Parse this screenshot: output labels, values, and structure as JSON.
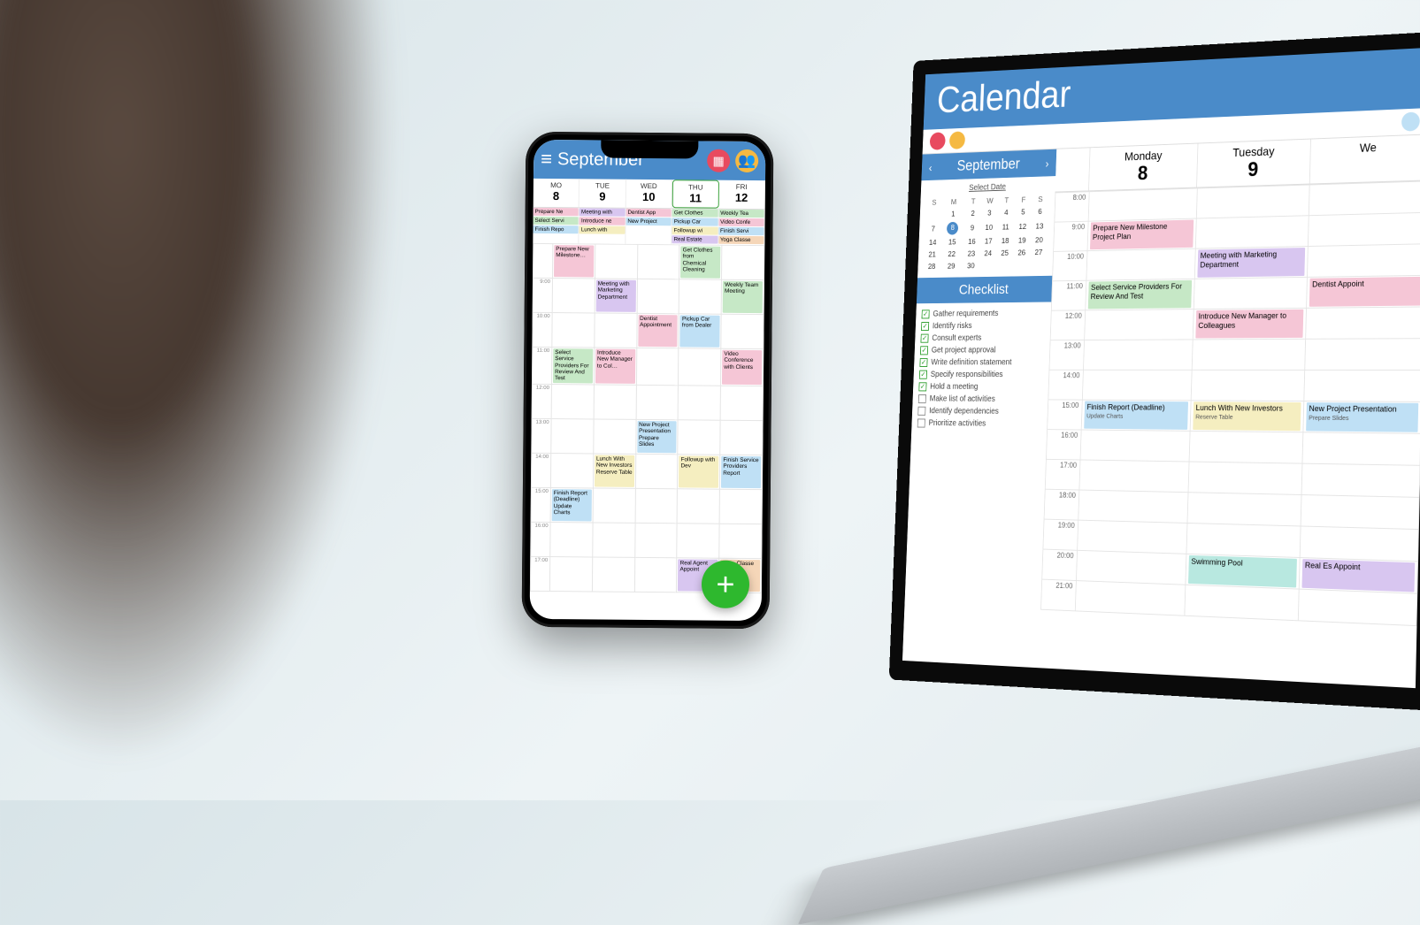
{
  "phone": {
    "header": {
      "month": "September"
    },
    "days": [
      {
        "name": "MO",
        "num": "8"
      },
      {
        "name": "TUE",
        "num": "9"
      },
      {
        "name": "WED",
        "num": "10"
      },
      {
        "name": "THU",
        "num": "11",
        "today": true
      },
      {
        "name": "FRI",
        "num": "12"
      }
    ],
    "chips": {
      "c0": [
        {
          "t": "Prepare Ne",
          "c": "c-pink"
        },
        {
          "t": "Select Servi",
          "c": "c-green"
        },
        {
          "t": "Finish Repo",
          "c": "c-blue"
        }
      ],
      "c1": [
        {
          "t": "Meeting with",
          "c": "c-purple"
        },
        {
          "t": "Introduce ne",
          "c": "c-pink"
        },
        {
          "t": "Lunch with",
          "c": "c-yellow"
        }
      ],
      "c2": [
        {
          "t": "Dentist App",
          "c": "c-pink"
        },
        {
          "t": "New Project",
          "c": "c-blue"
        }
      ],
      "c3": [
        {
          "t": "Get Clothes",
          "c": "c-green"
        },
        {
          "t": "Pickup Car",
          "c": "c-blue"
        },
        {
          "t": "Followup wi",
          "c": "c-yellow"
        },
        {
          "t": "Real Estate",
          "c": "c-purple"
        }
      ],
      "c4": [
        {
          "t": "Weekly Tea",
          "c": "c-green"
        },
        {
          "t": "Video Confe",
          "c": "c-pink"
        },
        {
          "t": "Finish Servi",
          "c": "c-blue"
        },
        {
          "t": "Yoga Classe",
          "c": "c-orange"
        }
      ]
    },
    "hours": [
      "",
      "9:00",
      "10:00",
      "11:00",
      "12:00",
      "13:00",
      "14:00",
      "15:00",
      "16:00",
      "17:00"
    ],
    "grid": [
      [
        null,
        {
          "t": "Prepare New Milestone…",
          "c": "c-pink"
        },
        null,
        null,
        {
          "t": "Get Clothes from Chemical Cleaning",
          "c": "c-green"
        },
        null
      ],
      [
        null,
        null,
        {
          "t": "Meeting with Marketing Department",
          "c": "c-purple"
        },
        null,
        null,
        {
          "t": "Weekly Team Meeting",
          "c": "c-green"
        }
      ],
      [
        null,
        null,
        null,
        {
          "t": "Dentist Appointment",
          "c": "c-pink"
        },
        {
          "t": "Pickup Car from Dealer",
          "c": "c-blue"
        },
        null
      ],
      [
        null,
        {
          "t": "Select Service Providers For Review And Test",
          "c": "c-green"
        },
        {
          "t": "Introduce New Manager to Col…",
          "c": "c-pink"
        },
        null,
        null,
        {
          "t": "Video Conference with Clients",
          "c": "c-pink"
        }
      ],
      [
        null,
        null,
        null,
        null,
        null,
        null
      ],
      [
        null,
        null,
        null,
        {
          "t": "New Project Presentation Prepare Slides",
          "c": "c-blue"
        },
        null,
        null
      ],
      [
        null,
        null,
        {
          "t": "Lunch With New Investors Reserve Table",
          "c": "c-yellow"
        },
        null,
        {
          "t": "Followup with Dev",
          "c": "c-yellow"
        },
        {
          "t": "Finish Service Providers Report",
          "c": "c-blue"
        }
      ],
      [
        null,
        {
          "t": "Finish Report (Deadline) Update Charts",
          "c": "c-blue"
        },
        null,
        null,
        null,
        null
      ],
      [
        null,
        null,
        null,
        null,
        null,
        null
      ],
      [
        null,
        null,
        null,
        null,
        {
          "t": "Real Agent Appoint",
          "c": "c-purple"
        },
        {
          "t": "Yoga Classe",
          "c": "c-orange"
        }
      ]
    ]
  },
  "laptop": {
    "title": "Calendar",
    "month": "September",
    "select_date": "Select Date",
    "weekdays": [
      "S",
      "M",
      "T",
      "W",
      "T",
      "F",
      "S"
    ],
    "mini": [
      [
        "",
        "1",
        "2",
        "3",
        "4",
        "5",
        "6"
      ],
      [
        "7",
        "8",
        "9",
        "10",
        "11",
        "12",
        "13"
      ],
      [
        "14",
        "15",
        "16",
        "17",
        "18",
        "19",
        "20"
      ],
      [
        "21",
        "22",
        "23",
        "24",
        "25",
        "26",
        "27"
      ],
      [
        "28",
        "29",
        "30",
        "",
        "",
        "",
        ""
      ]
    ],
    "selected": "8",
    "checklist_title": "Checklist",
    "checklist": [
      {
        "t": "Gather requirements",
        "d": true
      },
      {
        "t": "Identify risks",
        "d": true
      },
      {
        "t": "Consult experts",
        "d": true
      },
      {
        "t": "Get project approval",
        "d": true
      },
      {
        "t": "Write definition statement",
        "d": true
      },
      {
        "t": "Specify responsibilities",
        "d": true
      },
      {
        "t": "Hold a meeting",
        "d": true
      },
      {
        "t": "Make list of activities",
        "d": false
      },
      {
        "t": "Identify dependencies",
        "d": false
      },
      {
        "t": "Prioritize activities",
        "d": false
      }
    ],
    "days": [
      {
        "n": "Monday",
        "d": "8"
      },
      {
        "n": "Tuesday",
        "d": "9"
      },
      {
        "n": "We",
        "d": ""
      }
    ],
    "hours": [
      "8:00",
      "9:00",
      "10:00",
      "11:00",
      "12:00",
      "13:00",
      "14:00",
      "15:00",
      "16:00",
      "17:00",
      "18:00",
      "19:00",
      "20:00",
      "21:00"
    ],
    "grid": [
      [
        null,
        null,
        null
      ],
      [
        {
          "t": "Prepare New Milestone Project Plan",
          "c": "c-pink"
        },
        null,
        null
      ],
      [
        null,
        {
          "t": "Meeting with Marketing Department",
          "c": "c-purple"
        },
        null
      ],
      [
        {
          "t": "Select Service Providers For Review And Test",
          "c": "c-green"
        },
        null,
        {
          "t": "Dentist Appoint",
          "c": "c-pink"
        }
      ],
      [
        null,
        {
          "t": "Introduce New Manager to Colleagues",
          "c": "c-pink"
        },
        null
      ],
      [
        null,
        null,
        null
      ],
      [
        null,
        null,
        null
      ],
      [
        {
          "t": "Finish Report (Deadline)",
          "s": "Update Charts",
          "c": "c-blue"
        },
        {
          "t": "Lunch With New Investors",
          "s": "Reserve Table",
          "c": "c-yellow"
        },
        {
          "t": "New Project Presentation",
          "s": "Prepare Slides",
          "c": "c-blue"
        }
      ],
      [
        null,
        null,
        null
      ],
      [
        null,
        null,
        null
      ],
      [
        null,
        null,
        null
      ],
      [
        null,
        null,
        null
      ],
      [
        null,
        {
          "t": "Swimming Pool",
          "c": "c-teal"
        },
        {
          "t": "Real Es Appoint",
          "c": "c-purple"
        }
      ],
      [
        null,
        null,
        null
      ]
    ]
  }
}
